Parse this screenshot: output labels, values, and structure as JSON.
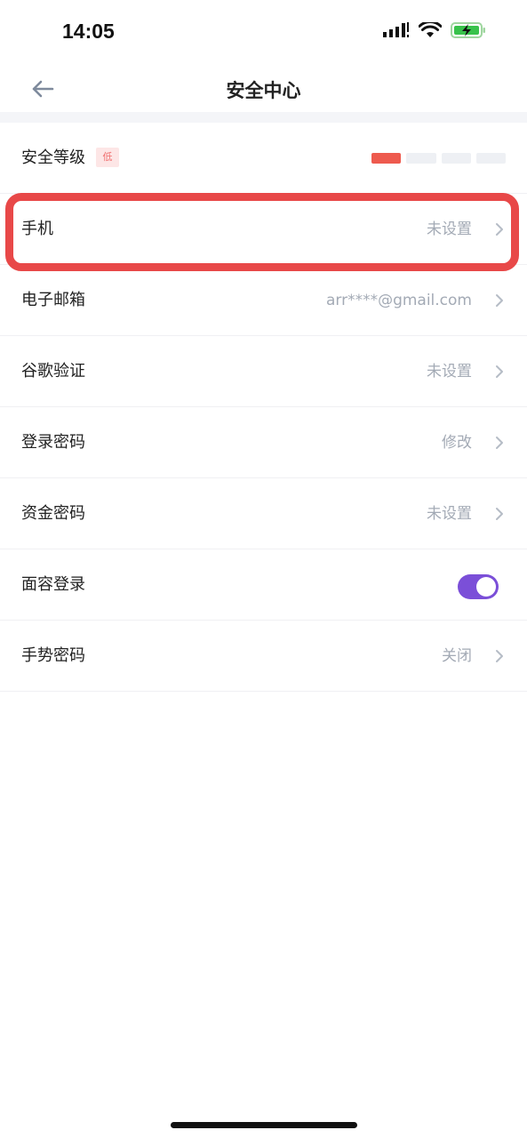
{
  "status_bar": {
    "time": "14:05"
  },
  "nav": {
    "title": "安全中心"
  },
  "security_level": {
    "label": "安全等级",
    "badge": "低",
    "level": 1,
    "max_level": 4
  },
  "rows": [
    {
      "label": "手机",
      "value": "未设置"
    },
    {
      "label": "电子邮箱",
      "value": "arr****@gmail.com"
    },
    {
      "label": "谷歌验证",
      "value": "未设置"
    },
    {
      "label": "登录密码",
      "value": "修改"
    },
    {
      "label": "资金密码",
      "value": "未设置"
    },
    {
      "label": "面容登录",
      "toggle_on": true
    },
    {
      "label": "手势密码",
      "value": "关闭"
    }
  ],
  "colors": {
    "accent": "#7b4fd8",
    "danger": "#e84848",
    "level_active": "#ee5a4e"
  }
}
